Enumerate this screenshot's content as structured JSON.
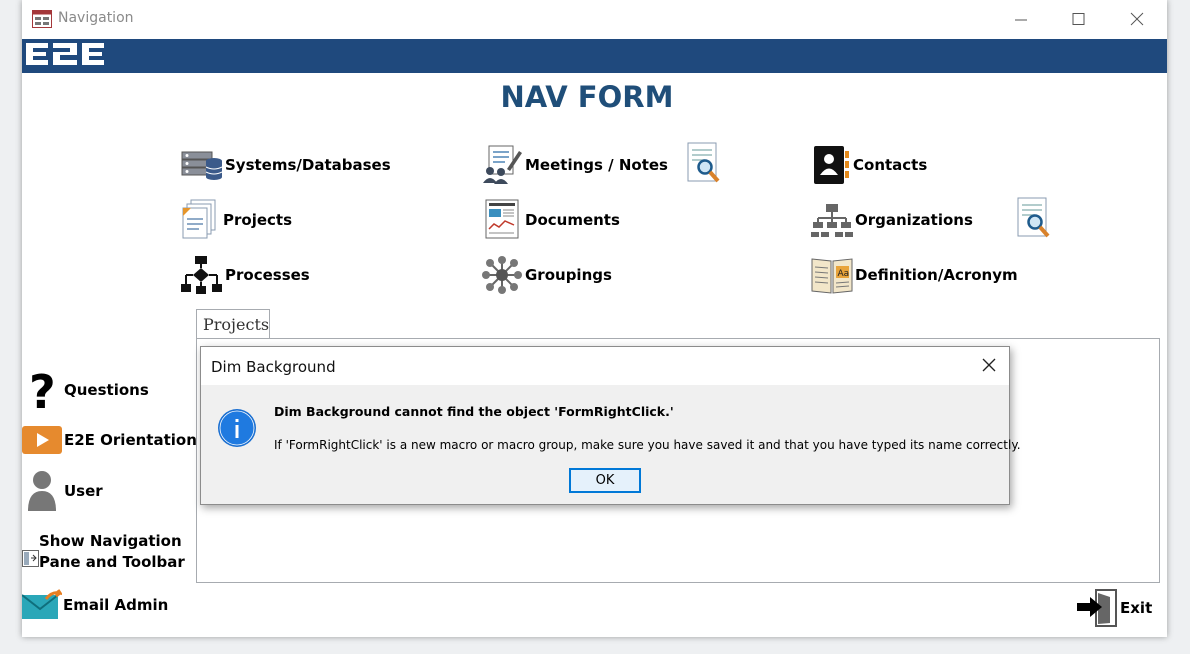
{
  "window": {
    "title": "Navigation"
  },
  "banner": {
    "logo_text": "E2E"
  },
  "form": {
    "title": "NAV FORM"
  },
  "nav_items": {
    "systems": "Systems/Databases",
    "meetings": "Meetings / Notes",
    "contacts": "Contacts",
    "projects": "Projects",
    "documents": "Documents",
    "organizations": "Organizations",
    "processes": "Processes",
    "groupings": "Groupings",
    "definition": "Definition/Acronym"
  },
  "tabs": {
    "projects": "Projects"
  },
  "sidebar": {
    "questions": "Questions",
    "orientation": "E2E Orientation",
    "user": "User",
    "show_nav_line1": "Show Navigation",
    "show_nav_line2": "Pane and Toolbar",
    "email_admin": "Email Admin",
    "exit": "Exit"
  },
  "dialog": {
    "title": "Dim Background",
    "message_bold": "Dim Background cannot find the object 'FormRightClick.'",
    "message": "If 'FormRightClick' is a new macro or macro group, make sure you have saved it and that you have typed its name correctly.",
    "ok_label": "OK"
  },
  "colors": {
    "banner": "#1f497d",
    "title": "#1f4e79",
    "info_icon": "#1a6fd1",
    "ok_border": "#0078d7"
  }
}
